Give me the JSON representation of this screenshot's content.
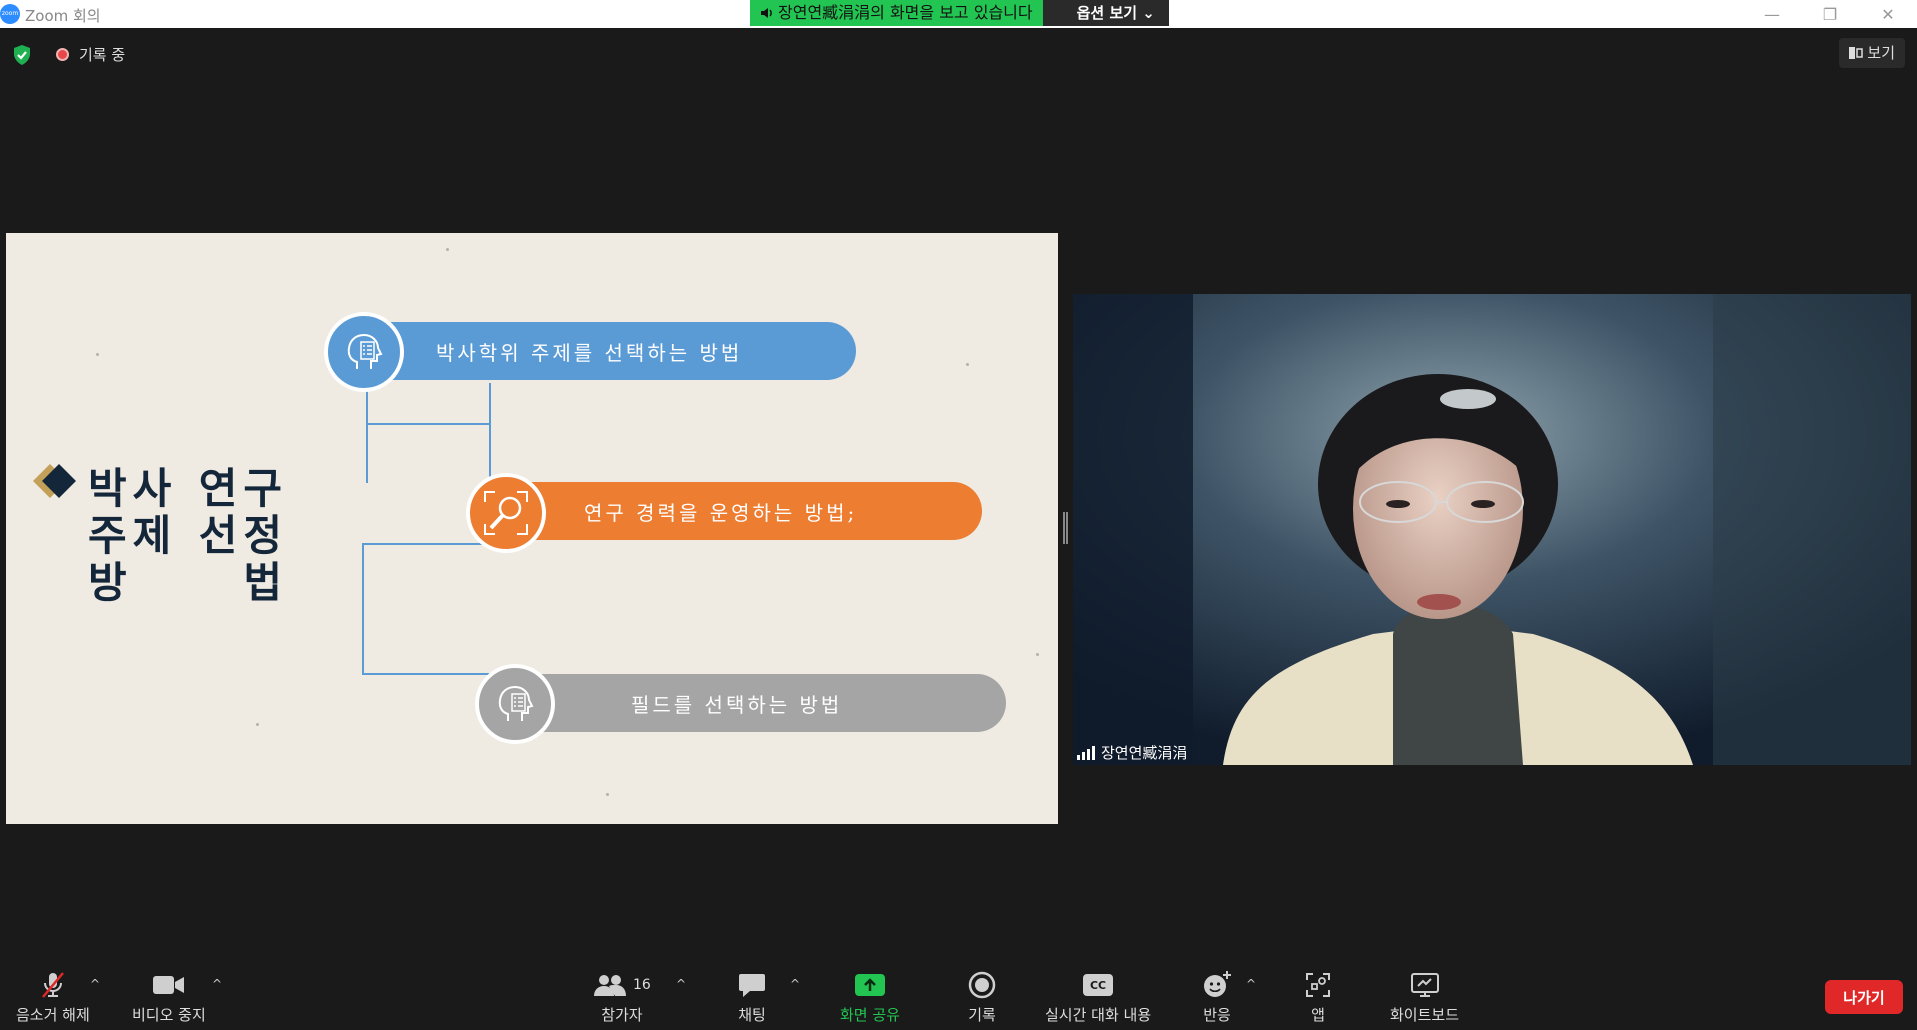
{
  "window": {
    "title": "Zoom 회의",
    "logo_text": "zoom"
  },
  "share_banner": {
    "viewing_text": "장연연臧涓涓의 화면을 보고 있습니다",
    "options_label": "옵션 보기"
  },
  "topbar": {
    "recording_label": "기록 중",
    "view_label": "보기"
  },
  "slide": {
    "title_lines": [
      [
        "박사",
        "연구"
      ],
      [
        "주제",
        "선정"
      ],
      [
        "방",
        "법"
      ]
    ],
    "items": [
      {
        "label": "박사학위 주제를 선택하는 방법",
        "color": "#5b9bd5",
        "icon": "head-checklist-icon"
      },
      {
        "label": "연구 경력을 운영하는 방법;",
        "color": "#ed7d31",
        "icon": "magnifier-icon"
      },
      {
        "label": "필드를 선택하는 방법",
        "color": "#a5a5a5",
        "icon": "head-checklist-icon"
      }
    ]
  },
  "video": {
    "participant_name": "장연연臧涓涓"
  },
  "toolbar": {
    "mute_label": "음소거 해제",
    "video_label": "비디오 중지",
    "participants_label": "참가자",
    "participants_count": "16",
    "chat_label": "채팅",
    "share_label": "화면 공유",
    "record_label": "기록",
    "captions_label": "실시간 대화 내용",
    "captions_icon_text": "CC",
    "reactions_label": "반응",
    "apps_label": "앱",
    "whiteboard_label": "화이트보드",
    "leave_label": "나가기"
  },
  "colors": {
    "accent_green": "#23c552",
    "leave_red": "#e02828",
    "background": "#1a1a1a"
  }
}
